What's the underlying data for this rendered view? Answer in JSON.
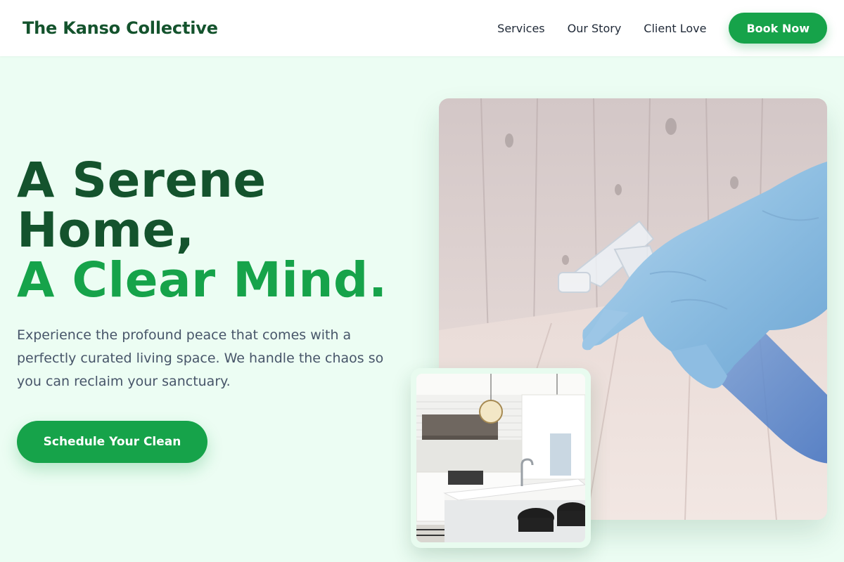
{
  "header": {
    "brand": "The Kanso Collective",
    "nav": [
      "Services",
      "Our Story",
      "Client Love"
    ],
    "cta_label": "Book Now"
  },
  "hero": {
    "headline_line1": "A Serene",
    "headline_line2": "Home,",
    "headline_line3": "A Clear Mind.",
    "subtitle": "Experience the profound peace that comes with a perfectly curated living space. We handle the chaos so you can reclaim your sanctuary.",
    "cta_label": "Schedule Your Clean"
  },
  "images": {
    "main": "photo-gloved-hand-spray-bottle",
    "inset": "photo-white-kitchen"
  },
  "colors": {
    "brand_dark": "#14532d",
    "accent": "#16a34a",
    "background": "#ecfdf3",
    "body_text": "#475569"
  }
}
